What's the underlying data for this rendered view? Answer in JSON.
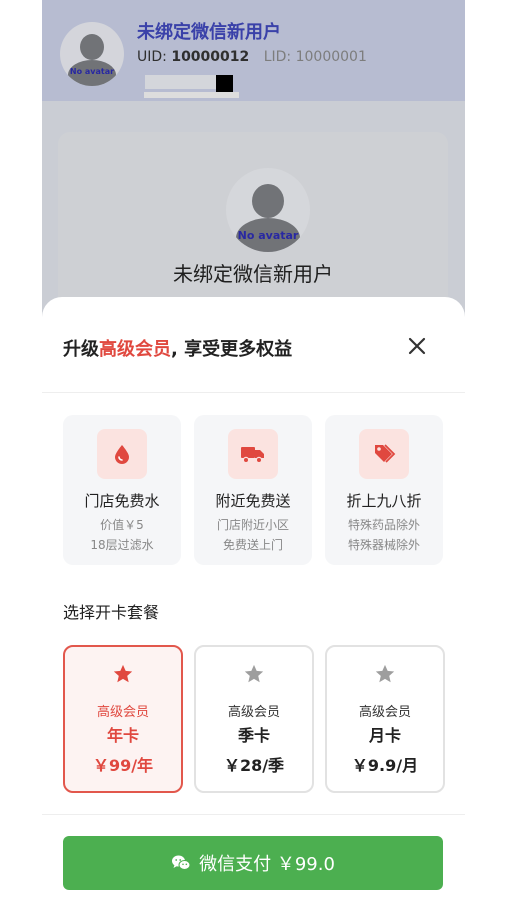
{
  "header": {
    "avatar_label": "No avatar",
    "name": "未绑定微信新用户",
    "uid_label": "UID:",
    "uid_value": "10000012",
    "lid_text": "LID: 10000001"
  },
  "profile_card": {
    "avatar_label": "No avatar",
    "name": "未绑定微信新用户"
  },
  "sheet": {
    "title_prefix": "升级",
    "title_accent": "高级会员",
    "title_suffix": ", 享受更多权益",
    "benefits": [
      {
        "icon": "water-drop-icon",
        "title": "门店免费水",
        "line1": "价值￥5",
        "line2": "18层过滤水"
      },
      {
        "icon": "delivery-truck-icon",
        "title": "附近免费送",
        "line1": "门店附近小区",
        "line2": "免费送上门"
      },
      {
        "icon": "discount-tag-icon",
        "title": "折上九八折",
        "line1": "特殊药品除外",
        "line2": "特殊器械除外"
      }
    ],
    "plans_label": "选择开卡套餐",
    "plans": [
      {
        "tier": "高级会员",
        "period": "年卡",
        "price": "￥99/年",
        "selected": true
      },
      {
        "tier": "高级会员",
        "period": "季卡",
        "price": "￥28/季",
        "selected": false
      },
      {
        "tier": "高级会员",
        "period": "月卡",
        "price": "￥9.9/月",
        "selected": false
      }
    ],
    "pay_label": "微信支付 ￥99.0"
  },
  "colors": {
    "accent": "#e0483f",
    "pay_green": "#4caf50",
    "header_name": "#3f47b8"
  }
}
